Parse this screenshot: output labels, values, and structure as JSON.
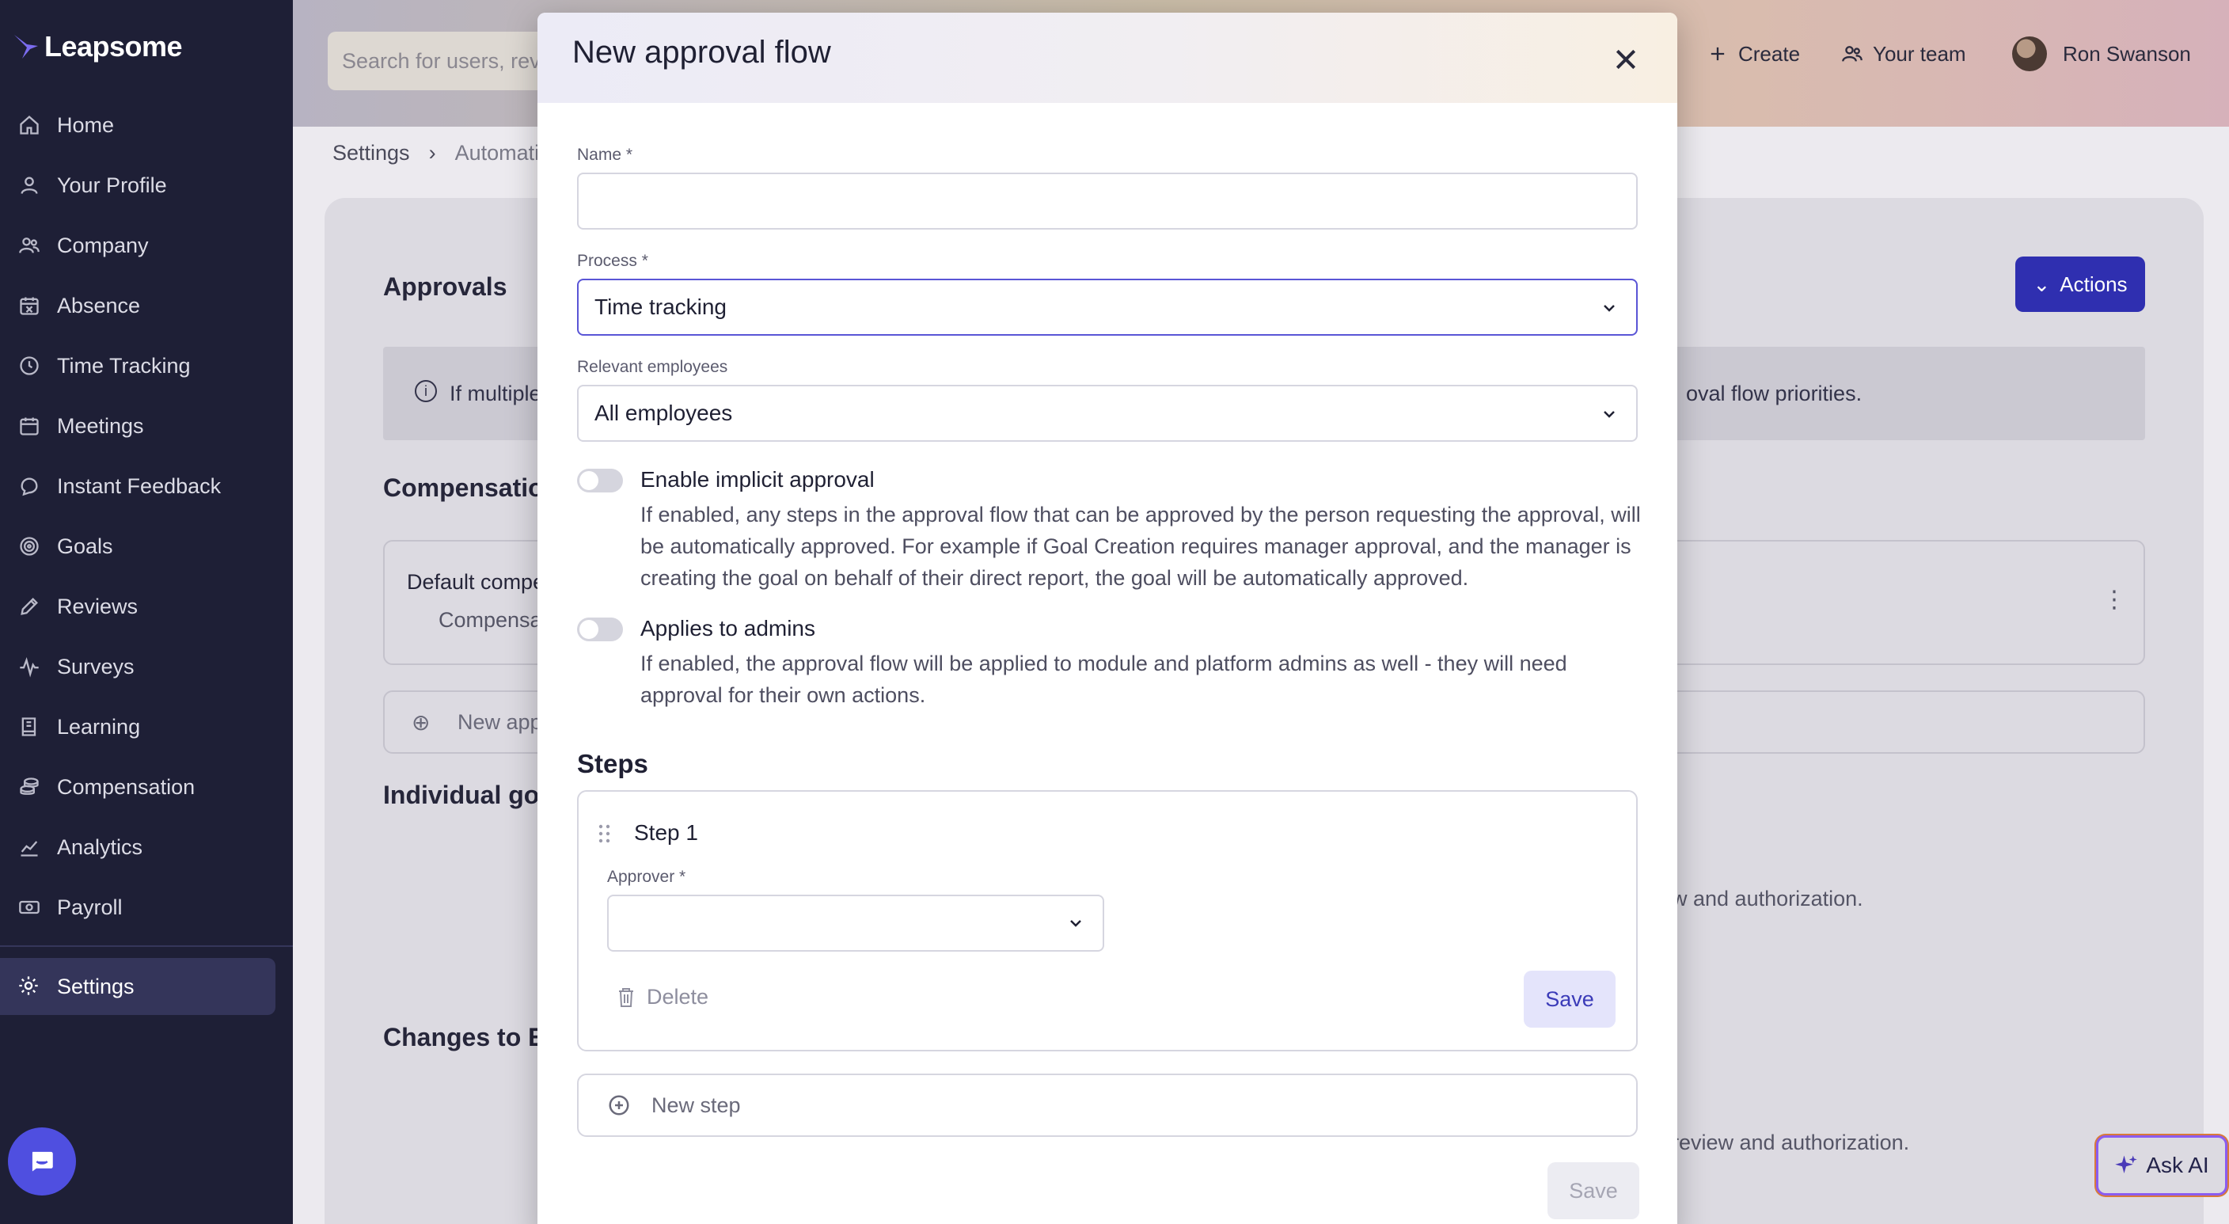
{
  "app": {
    "brand": "Leapsome"
  },
  "sidebar": {
    "items": [
      {
        "label": "Home",
        "icon": "home-icon"
      },
      {
        "label": "Your Profile",
        "icon": "user-icon"
      },
      {
        "label": "Company",
        "icon": "users-icon"
      },
      {
        "label": "Absence",
        "icon": "calendar-x-icon"
      },
      {
        "label": "Time Tracking",
        "icon": "clock-icon"
      },
      {
        "label": "Meetings",
        "icon": "calendar-icon"
      },
      {
        "label": "Instant Feedback",
        "icon": "chat-icon"
      },
      {
        "label": "Goals",
        "icon": "target-icon"
      },
      {
        "label": "Reviews",
        "icon": "pen-icon"
      },
      {
        "label": "Surveys",
        "icon": "pulse-icon"
      },
      {
        "label": "Learning",
        "icon": "book-icon"
      },
      {
        "label": "Compensation",
        "icon": "coins-icon"
      },
      {
        "label": "Analytics",
        "icon": "chart-icon"
      },
      {
        "label": "Payroll",
        "icon": "money-icon"
      }
    ],
    "settings_label": "Settings"
  },
  "topbar": {
    "search_placeholder": "Search for users, revi",
    "create_label": "Create",
    "team_label": "Your team",
    "user_name": "Ron Swanson"
  },
  "background": {
    "breadcrumb_settings": "Settings",
    "breadcrumb_current": "Automati",
    "approvals_title": "Approvals",
    "actions_label": "Actions",
    "info_text_left": "If multiple",
    "info_text_right": "oval flow priorities.",
    "compensation_heading": "Compensatio",
    "default_flow_title": "Default compe",
    "default_flow_sub": "Compensa",
    "new_approval_flow": "New app",
    "individual_goals_heading": "Individual go",
    "individual_goals_text": "w and authorization.",
    "changes_heading": "Changes to E",
    "changes_text": "review and authorization.",
    "ask_ai_label": "Ask AI"
  },
  "modal": {
    "title": "New approval flow",
    "name_label": "Name *",
    "name_value": "",
    "process_label": "Process *",
    "process_value": "Time tracking",
    "employees_label": "Relevant employees",
    "employees_value": "All employees",
    "implicit_label": "Enable implicit approval",
    "implicit_desc": "If enabled, any steps in the approval flow that can be approved by the person requesting the approval, will be automatically approved. For example if Goal Creation requires manager approval, and the manager is creating the goal on behalf of their direct report, the goal will be automatically approved.",
    "admins_label": "Applies to admins",
    "admins_desc": "If enabled, the approval flow will be applied to module and platform admins as well - they will need approval for their own actions.",
    "steps_title": "Steps",
    "step_name": "Step 1",
    "approver_label": "Approver *",
    "delete_label": "Delete",
    "step_save_label": "Save",
    "new_step_label": "New step",
    "save_label": "Save"
  },
  "colors": {
    "sidebar_bg": "#1e1f36",
    "accent": "#2f2fb0",
    "focus_border": "#5a55d6"
  }
}
